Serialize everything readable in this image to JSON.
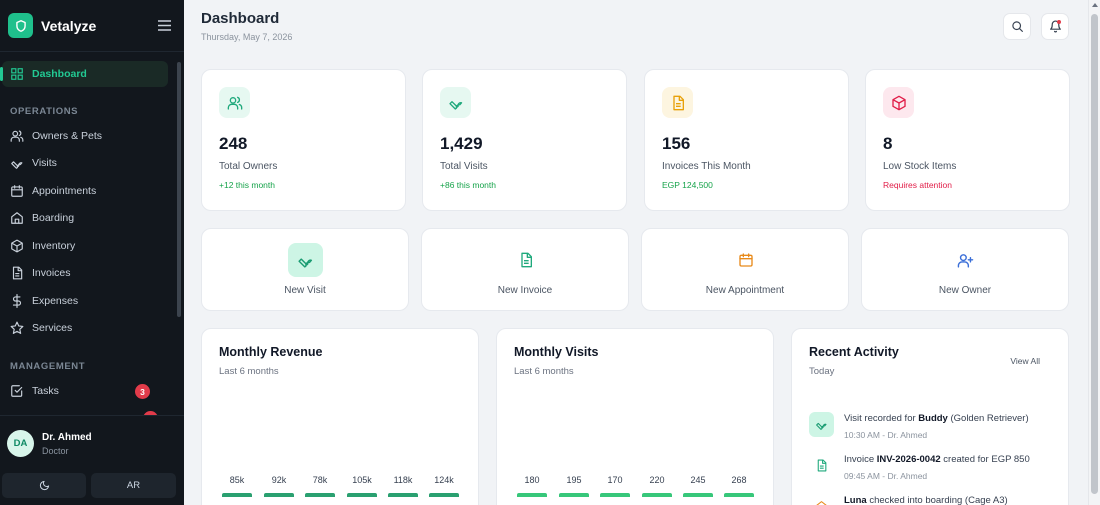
{
  "app": {
    "name": "Vetalyze"
  },
  "sidebar": {
    "dashboard": "Dashboard",
    "sections": {
      "operations": "OPERATIONS",
      "management": "MANAGEMENT"
    },
    "operations": [
      {
        "label": "Owners & Pets",
        "icon": "users-icon"
      },
      {
        "label": "Visits",
        "icon": "wrench-icon"
      },
      {
        "label": "Appointments",
        "icon": "calendar-icon"
      },
      {
        "label": "Boarding",
        "icon": "home-icon"
      },
      {
        "label": "Inventory",
        "icon": "box-icon"
      },
      {
        "label": "Invoices",
        "icon": "file-icon"
      },
      {
        "label": "Expenses",
        "icon": "dollar-icon"
      },
      {
        "label": "Services",
        "icon": "star-icon"
      }
    ],
    "management": [
      {
        "label": "Tasks",
        "icon": "check-square-icon",
        "badge": "3"
      }
    ],
    "user": {
      "initials": "DA",
      "name": "Dr. Ahmed",
      "role": "Doctor"
    },
    "lang_button": "AR"
  },
  "header": {
    "title": "Dashboard",
    "date": "Thursday, May 7, 2026"
  },
  "stats": [
    {
      "value": "248",
      "label": "Total Owners",
      "sub": "+12 this month",
      "sub_color": "#16a34a",
      "icon": "users-icon",
      "accent": "#1fa97c"
    },
    {
      "value": "1,429",
      "label": "Total Visits",
      "sub": "+86 this month",
      "sub_color": "#16a34a",
      "icon": "wrench-icon",
      "accent": "#1fa97c"
    },
    {
      "value": "156",
      "label": "Invoices This Month",
      "sub": "EGP 124,500",
      "sub_color": "#16a34a",
      "icon": "file-icon",
      "accent": "#e8a10a"
    },
    {
      "value": "8",
      "label": "Low Stock Items",
      "sub": "Requires attention",
      "sub_color": "#e11d48",
      "icon": "box-icon",
      "accent": "#e11d48"
    }
  ],
  "actions": [
    {
      "label": "New Visit",
      "icon": "wrench-icon"
    },
    {
      "label": "New Invoice",
      "icon": "file-icon"
    },
    {
      "label": "New Appointment",
      "icon": "calendar-icon"
    },
    {
      "label": "New Owner",
      "icon": "user-plus-icon"
    }
  ],
  "revenue": {
    "title": "Monthly Revenue",
    "subtitle": "Last 6 months"
  },
  "visits": {
    "title": "Monthly Visits",
    "subtitle": "Last 6 months"
  },
  "chart_data": [
    {
      "type": "bar",
      "title": "Monthly Revenue",
      "values": [
        85,
        92,
        78,
        105,
        118,
        124
      ],
      "value_labels": [
        "85k",
        "92k",
        "78k",
        "105k",
        "118k",
        "124k"
      ],
      "color": "#2aa070"
    },
    {
      "type": "bar",
      "title": "Monthly Visits",
      "values": [
        180,
        195,
        170,
        220,
        245,
        268
      ],
      "value_labels": [
        "180",
        "195",
        "170",
        "220",
        "245",
        "268"
      ],
      "color": "#37c77a"
    }
  ],
  "activity": {
    "title": "Recent Activity",
    "subtitle": "Today",
    "view_all": "View All",
    "items": [
      {
        "icon": "wrench-icon",
        "pre": "Visit recorded for ",
        "bold": "Buddy",
        "post": " (Golden Retriever)",
        "time": "10:30 AM - Dr. Ahmed"
      },
      {
        "icon": "file-icon",
        "pre": "Invoice ",
        "bold": "INV-2026-0042",
        "post": " created for EGP 850",
        "time": "09:45 AM - Dr. Ahmed"
      },
      {
        "icon": "home-icon",
        "pre": "",
        "bold": "Luna",
        "post": " checked into boarding (Cage A3)",
        "time": ""
      }
    ]
  }
}
